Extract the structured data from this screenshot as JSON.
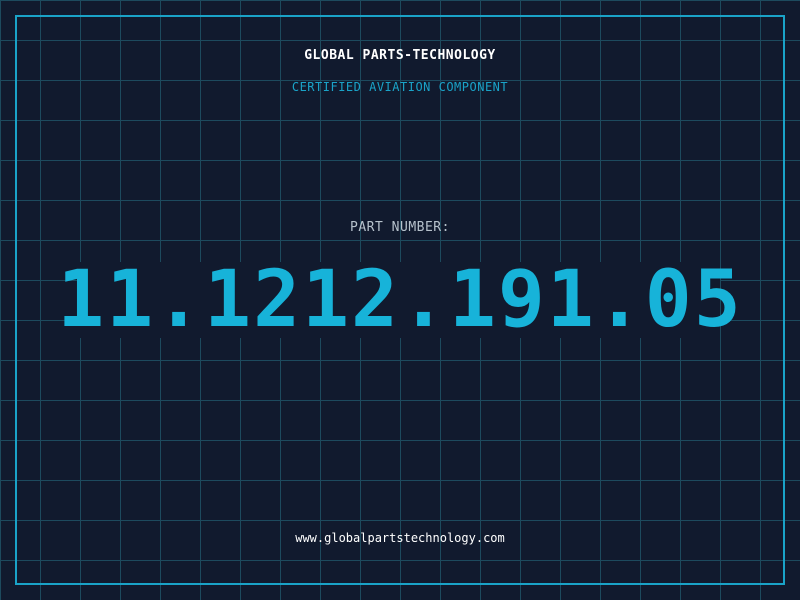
{
  "header": {
    "company": "GLOBAL PARTS-TECHNOLOGY",
    "subtitle": "CERTIFIED AVIATION COMPONENT"
  },
  "part": {
    "label": "PART NUMBER:",
    "number": "11.1212.191.05"
  },
  "footer": {
    "website": "www.globalpartstechnology.com"
  },
  "colors": {
    "background": "#111a2e",
    "grid": "#1d4a5e",
    "accent": "#1aa3c8",
    "part_number": "#17b3d9",
    "text_primary": "#ffffff",
    "text_secondary": "#b7c2cc"
  }
}
